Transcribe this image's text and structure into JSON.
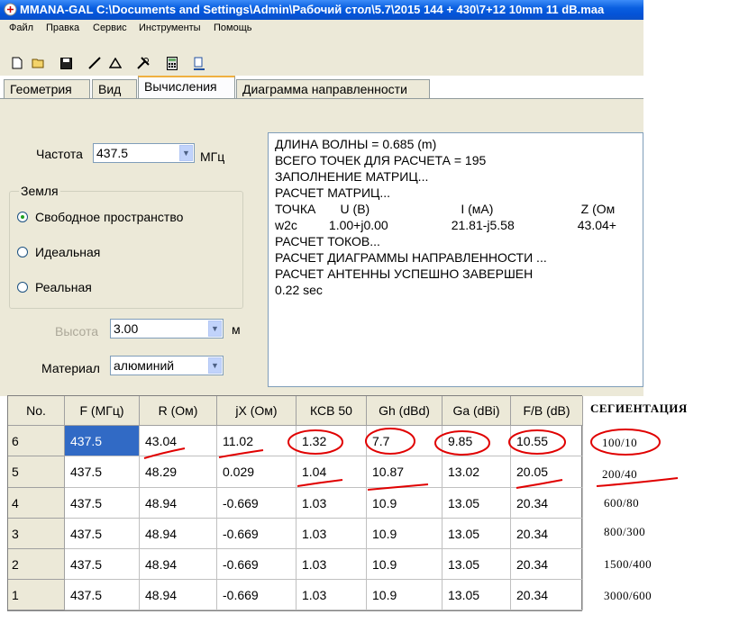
{
  "window": {
    "title": "MMANA-GAL C:\\Documents and Settings\\Admin\\Рабочий стол\\5.7\\2015 144 + 430\\7+12 10mm 11 dB.maa"
  },
  "menu": [
    "Файл",
    "Правка",
    "Сервис",
    "Инструменты",
    "Помощь"
  ],
  "toolbar": {
    "icons": [
      "new-file-icon",
      "open-folder-icon",
      "save-disk-icon",
      "line-tool-icon",
      "triangle-tool-icon",
      "tools-icon",
      "calculator-icon",
      "wire-table-icon"
    ]
  },
  "tabs": [
    "Геометрия",
    "Вид",
    "Вычисления",
    "Диаграмма направленности"
  ],
  "active_tab": "Вычисления",
  "calc": {
    "freq_label": "Частота",
    "freq_value": "437.5",
    "freq_unit": "МГц",
    "ground_group": "Земля",
    "ground_options": [
      "Свободное пространство",
      "Идеальная",
      "Реальная"
    ],
    "ground_selected": "Свободное пространство",
    "height_label": "Высота",
    "height_value": "3.00",
    "height_unit": "м",
    "material_label": "Материал",
    "material_value": "алюминий"
  },
  "output_lines": [
    "ДЛИНА ВОЛНЫ = 0.685 (m)",
    "ВСЕГО ТОЧЕК ДЛЯ РАСЧЕТА = 195",
    "ЗАПОЛНЕНИЕ МАТРИЦ...",
    "РАСЧЕТ МАТРИЦ...",
    "ТОЧКА       U (B)                          I (мА)                         Z (Ом",
    "w2c         1.00+j0.00                  21.81-j5.58                  43.04+",
    "РАСЧЕТ ТОКОВ...",
    "РАСЧЕТ ДИАГРАММЫ НАПРАВЛЕННОСТИ ...",
    "РАСЧЕТ АНТЕННЫ УСПЕШНО ЗАВЕРШЕН",
    "0.22 sec"
  ],
  "table": {
    "headers": [
      "No.",
      "F (МГц)",
      "R (Ом)",
      "jX (Ом)",
      "КСВ 50",
      "Gh (dBd)",
      "Ga (dBi)",
      "F/B (dB)"
    ],
    "rows": [
      [
        "6",
        "437.5",
        "43.04",
        "11.02",
        "1.32",
        "7.7",
        "9.85",
        "10.55"
      ],
      [
        "5",
        "437.5",
        "48.29",
        "0.029",
        "1.04",
        "10.87",
        "13.02",
        "20.05"
      ],
      [
        "4",
        "437.5",
        "48.94",
        "-0.669",
        "1.03",
        "10.9",
        "13.05",
        "20.34"
      ],
      [
        "3",
        "437.5",
        "48.94",
        "-0.669",
        "1.03",
        "10.9",
        "13.05",
        "20.34"
      ],
      [
        "2",
        "437.5",
        "48.94",
        "-0.669",
        "1.03",
        "10.9",
        "13.05",
        "20.34"
      ],
      [
        "1",
        "437.5",
        "48.94",
        "-0.669",
        "1.03",
        "10.9",
        "13.05",
        "20.34"
      ]
    ]
  },
  "annotations": {
    "heading": "СЕГИЕНТАЦИЯ",
    "segments": [
      "100/10",
      "200/40",
      "600/80",
      "800/300",
      "1500/400",
      "3000/600"
    ],
    "mark_color": "#e00000"
  },
  "colors": {
    "titlebar": "#0a5fe0",
    "selection": "#316ac5",
    "panel": "#ece9d8"
  }
}
